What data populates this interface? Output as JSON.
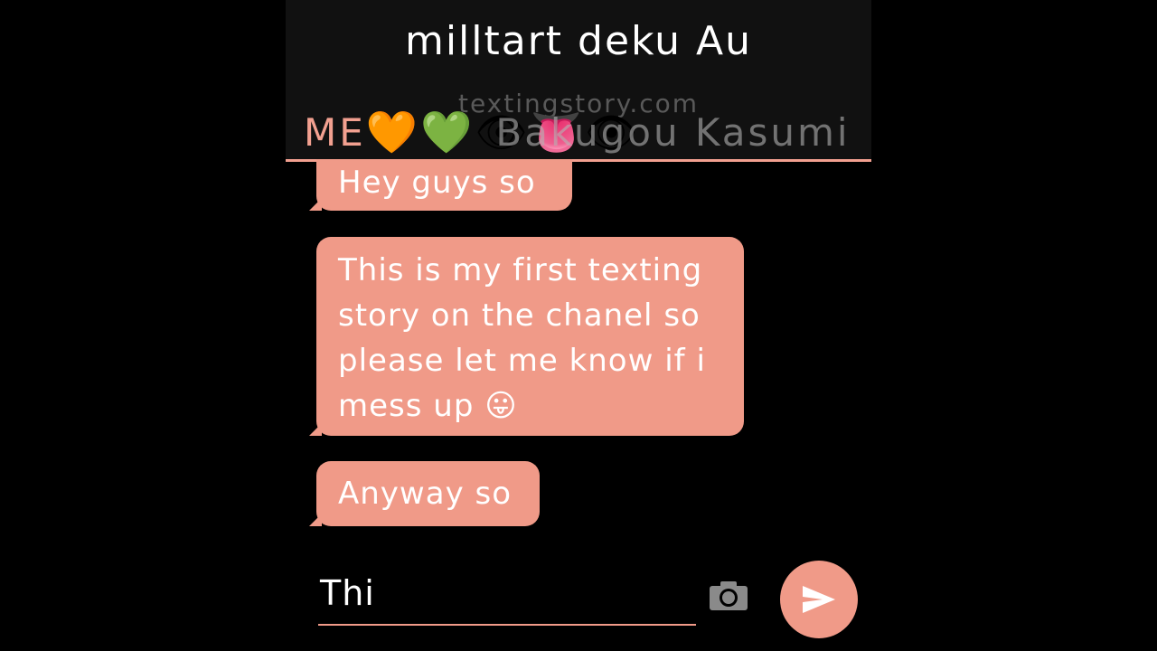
{
  "header": {
    "title": "milltart deku Au",
    "watermark": "textingstory.com",
    "subtitle_me": "ME",
    "subtitle_emojis": "🧡💚👁👅👁",
    "subtitle_names": "Bakugou Kasumi"
  },
  "messages": [
    {
      "text": "Hey guys so"
    },
    {
      "text": "This is my first texting story on the chanel so please let me know if i mess up 😛"
    },
    {
      "text": "Anyway so"
    }
  ],
  "composer": {
    "input_value": "Thi"
  },
  "icons": {
    "camera": "camera-icon",
    "send": "send-icon"
  },
  "colors": {
    "accent": "#f09a88",
    "header_bg": "#111111",
    "background": "#000000"
  }
}
